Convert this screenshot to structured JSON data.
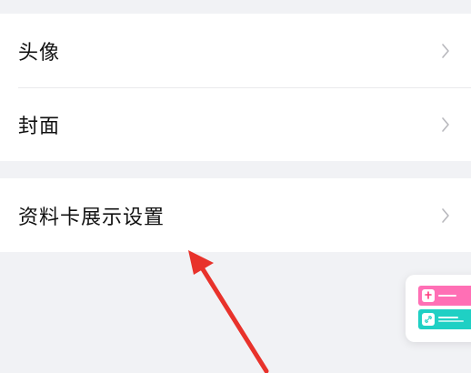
{
  "settings": {
    "group1": [
      {
        "label": "头像"
      },
      {
        "label": "封面"
      }
    ],
    "group2": [
      {
        "label": "资料卡展示设置"
      }
    ]
  },
  "colors": {
    "background": "#f1f2f5",
    "annotation_arrow": "#e8322b",
    "card_pink": "#ff6fb5",
    "card_teal": "#1fd0c4"
  },
  "icons": {
    "chevron": "chevron-right-icon",
    "card_top": "tiktok-icon",
    "card_bottom": "link-icon"
  }
}
